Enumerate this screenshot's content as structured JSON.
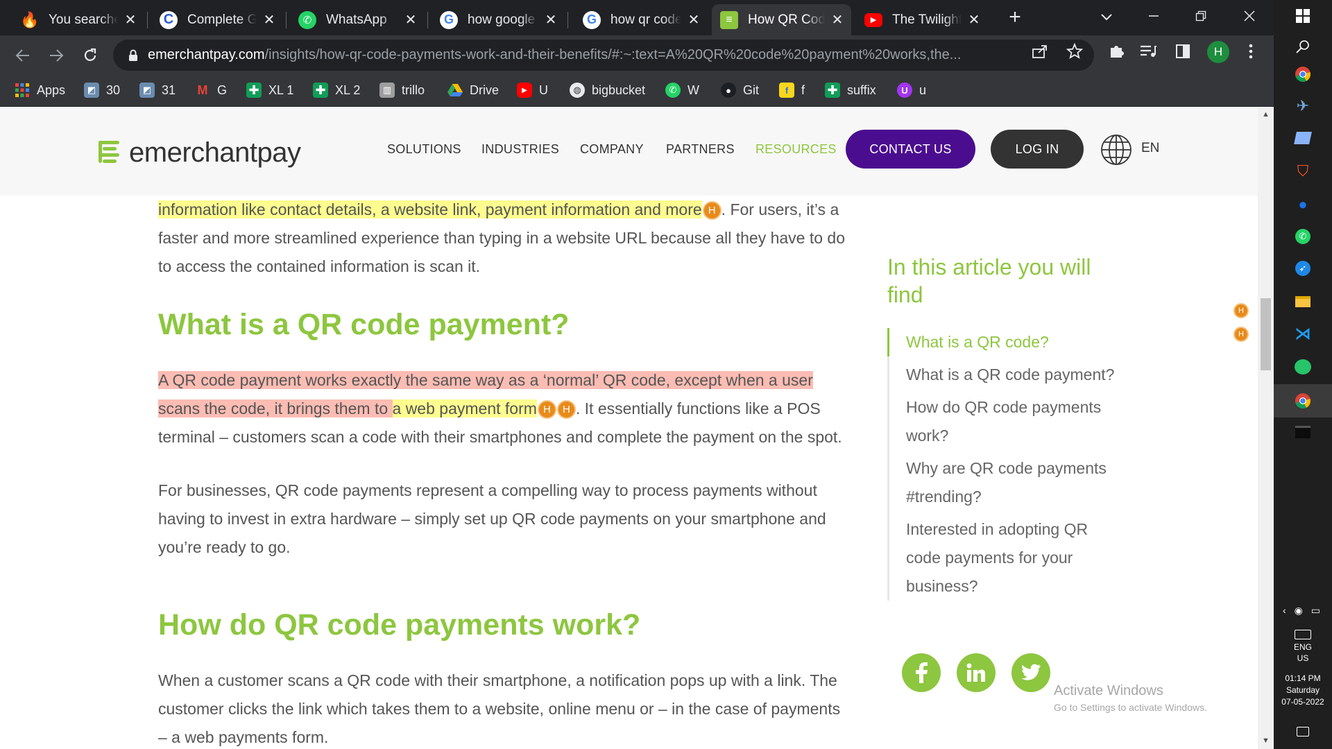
{
  "browser": {
    "tabs": [
      {
        "title": "You searched for",
        "icon": "vivino-icon",
        "color": "#c8102e"
      },
      {
        "title": "Complete Guide",
        "icon": "c-logo-icon",
        "color": "#3b82f6"
      },
      {
        "title": "WhatsApp",
        "icon": "whatsapp-icon",
        "color": "#25d366"
      },
      {
        "title": "how google pay",
        "icon": "google-icon",
        "color": "#ffffff"
      },
      {
        "title": "how qr code",
        "icon": "google-icon",
        "color": "#ffffff"
      },
      {
        "title": "How QR Codes",
        "icon": "emerchantpay-icon",
        "color": "#8dc63f",
        "active": true
      },
      {
        "title": "The Twilight Saga",
        "icon": "youtube-icon",
        "color": "#ff0000"
      }
    ],
    "new_tab_label": "+",
    "url_host": "emerchantpay.com",
    "url_path": "/insights/how-qr-code-payments-work-and-their-benefits/#:~:text=A%20QR%20code%20payment%20works,the...",
    "profile_initial": "H",
    "bookmarks": [
      {
        "label": "Apps",
        "icon": "apps-grid-icon",
        "color": "#ea4335"
      },
      {
        "label": "30",
        "icon": "bookmark-site-icon",
        "color": "#6a8caf"
      },
      {
        "label": "31",
        "icon": "bookmark-site-icon",
        "color": "#6a8caf"
      },
      {
        "label": "G",
        "icon": "gmail-icon",
        "color": "#ea4335"
      },
      {
        "label": "XL 1",
        "icon": "sheets-icon",
        "color": "#0f9d58"
      },
      {
        "label": "XL 2",
        "icon": "sheets-icon",
        "color": "#0f9d58"
      },
      {
        "label": "trillo",
        "icon": "trello-icon",
        "color": "#9e9e9e"
      },
      {
        "label": "Drive",
        "icon": "drive-icon",
        "color": "#fbbc04"
      },
      {
        "label": "U",
        "icon": "youtube-icon",
        "color": "#ff0000"
      },
      {
        "label": "bigbucket",
        "icon": "globe-icon",
        "color": "#9e9e9e"
      },
      {
        "label": "W",
        "icon": "whatsapp-icon",
        "color": "#25d366"
      },
      {
        "label": "Git",
        "icon": "github-icon",
        "color": "#1b1f23"
      },
      {
        "label": "f",
        "icon": "flipkart-icon",
        "color": "#f9d71c"
      },
      {
        "label": "suffix",
        "icon": "sheets-icon",
        "color": "#0f9d58"
      },
      {
        "label": "u",
        "icon": "udemy-icon",
        "color": "#a435f0"
      }
    ]
  },
  "site": {
    "logo_text": "emerchantpay",
    "nav": [
      "SOLUTIONS",
      "INDUSTRIES",
      "COMPANY",
      "PARTNERS",
      "RESOURCES"
    ],
    "contact_label": "CONTACT US",
    "login_label": "LOG IN",
    "lang": "EN",
    "accent": "#8dc63f",
    "purple": "#4b0d8f"
  },
  "article": {
    "p1_hl": "information like contact details, a website link, payment information and more",
    "p1_rest": ". For users, it’s a faster and more streamlined experience than typing in a website URL because all they have to do to access the contained information is scan it.",
    "h_what": "What is a QR code payment?",
    "p2_red": "A QR code payment works exactly the same way as a ‘normal’ QR code, except when a user scans the code, it brings them to",
    "p2_space": " ",
    "p2_yellow": "a web payment form",
    "p2_rest": ". It essentially functions like a POS terminal – customers scan a code with their smartphones and complete the payment on the spot.",
    "p3": "For businesses, QR code payments represent a compelling way to process payments without having to invest in extra hardware – simply set up QR code payments on your smartphone and you’re ready to go.",
    "h_how": "How do QR code payments work?",
    "p4": "When a customer scans a QR code with their smartphone, a notification pops up with a link. The customer clicks the link which takes them to a website, online menu or – in the case of payments – a web payments form.",
    "badge": "H"
  },
  "toc": {
    "title": "In this article you will find",
    "items": [
      "What is a QR code?",
      "What is a QR code payment?",
      "How do QR code payments work?",
      "Why are QR code payments #trending?",
      "Interested in adopting QR code payments for your business?"
    ]
  },
  "windows": {
    "activate_title": "Activate Windows",
    "activate_sub": "Go to Settings to activate Windows.",
    "lang1": "ENG",
    "lang2": "US",
    "time": "01:14 PM",
    "day": "Saturday",
    "date": "07-05-2022"
  }
}
